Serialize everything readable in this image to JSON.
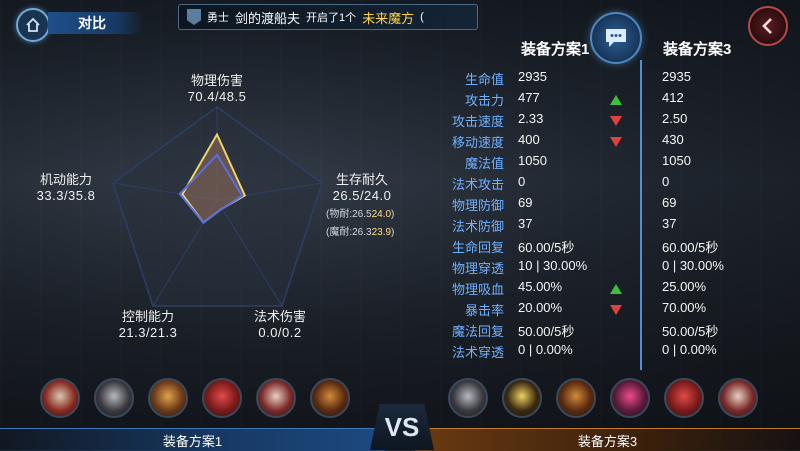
{
  "header": {
    "title": "对比",
    "notice": {
      "prefix": "勇士",
      "name": "剑的渡船夫",
      "mid": "开启了1个",
      "item": "未来魔方",
      "tail": "("
    }
  },
  "radar": {
    "physical": {
      "label": "物理伤害",
      "value": "70.4/48.5"
    },
    "survival": {
      "label": "生存耐久",
      "value": "26.5/24.0",
      "sub1_label": "(物耐:26.5",
      "sub1_val": "24.0",
      "sub2_label": "(魔耐:26.3",
      "sub2_val": "23.9",
      "close": ")"
    },
    "magic": {
      "label": "法术伤害",
      "value": "0.0/0.2"
    },
    "control": {
      "label": "控制能力",
      "value": "21.3/21.3"
    },
    "mobility": {
      "label": "机动能力",
      "value": "33.3/35.8"
    },
    "scores_a": [
      70.4,
      26.5,
      0.0,
      21.3,
      33.3
    ],
    "scores_b": [
      48.5,
      24.0,
      0.2,
      21.3,
      35.8
    ],
    "color_a": "#f2d36b",
    "color_b": "#5b6fd8"
  },
  "table": {
    "col1": "装备方案1",
    "col3": "装备方案3",
    "rows": [
      {
        "label": "生命值",
        "v1": "2935",
        "arrow": "",
        "v3": "2935"
      },
      {
        "label": "攻击力",
        "v1": "477",
        "arrow": "up",
        "v3": "412"
      },
      {
        "label": "攻击速度",
        "v1": "2.33",
        "arrow": "down",
        "v3": "2.50"
      },
      {
        "label": "移动速度",
        "v1": "400",
        "arrow": "down",
        "v3": "430"
      },
      {
        "label": "魔法值",
        "v1": "1050",
        "arrow": "",
        "v3": "1050"
      },
      {
        "label": "法术攻击",
        "v1": "0",
        "arrow": "",
        "v3": "0"
      },
      {
        "label": "物理防御",
        "v1": "69",
        "arrow": "",
        "v3": "69"
      },
      {
        "label": "法术防御",
        "v1": "37",
        "arrow": "",
        "v3": "37"
      },
      {
        "label": "生命回复",
        "v1": "60.00/5秒",
        "arrow": "",
        "v3": "60.00/5秒"
      },
      {
        "label": "物理穿透",
        "v1": "10 | 30.00%",
        "arrow": "",
        "v3": "0 | 30.00%"
      },
      {
        "label": "物理吸血",
        "v1": "45.00%",
        "arrow": "up",
        "v3": "25.00%"
      },
      {
        "label": "暴击率",
        "v1": "20.00%",
        "arrow": "down",
        "v3": "70.00%"
      },
      {
        "label": "魔法回复",
        "v1": "50.00/5秒",
        "arrow": "",
        "v3": "50.00/5秒"
      },
      {
        "label": "法术穿透",
        "v1": "0 | 0.00%",
        "arrow": "",
        "v3": "0 | 0.00%"
      }
    ]
  },
  "bottom": {
    "left_label": "装备方案1",
    "right_label": "装备方案3",
    "vs": "VS",
    "items_left": [
      "axe-item-icon",
      "boots-item-icon",
      "shield-item-icon",
      "armor-item-icon",
      "blade-item-icon",
      "sword-item-icon"
    ],
    "items_right": [
      "boots-item-icon",
      "trident-item-icon",
      "sword-item-icon",
      "gem-item-icon",
      "armor-item-icon",
      "blade-item-icon"
    ]
  }
}
